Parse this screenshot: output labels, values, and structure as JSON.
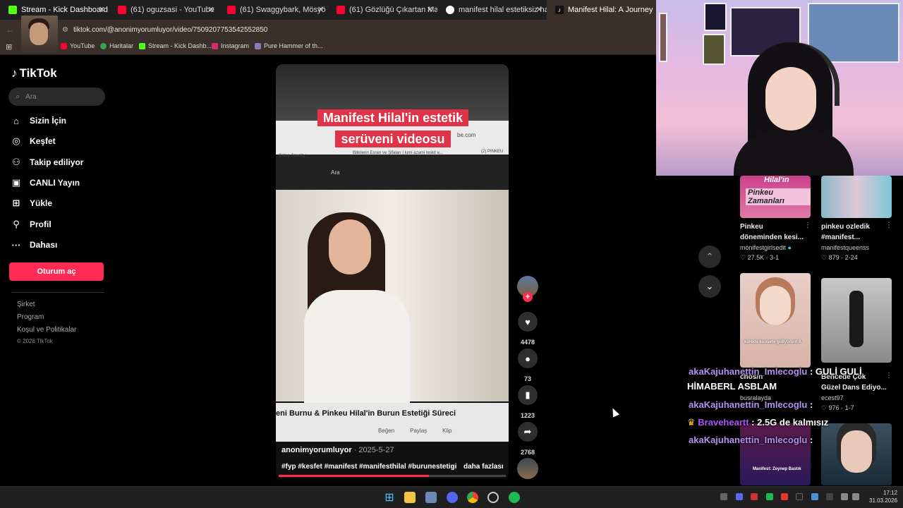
{
  "browser": {
    "tabs": [
      {
        "title": "Stream - Kick Dashboard",
        "color": "#53fc18"
      },
      {
        "title": "(61) oguzsasi - YouTube",
        "color": "#ff0033"
      },
      {
        "title": "(61) Swaggybark, Mösyö Taha T",
        "color": "#ff0033"
      },
      {
        "title": "(61) Gözlüğü Çıkartan Manifest",
        "color": "#ff0033"
      },
      {
        "title": "manifest hilal estetiksiz hali - G",
        "color": "#ffffff"
      },
      {
        "title": "Manifest Hilal: A Journey",
        "color": "#111111"
      }
    ],
    "url": "tiktok.com/@anonimyorumluyor/video/7509207753542552850",
    "bookmarks": [
      "YouTube",
      "Haritalar",
      "Stream - Kick Dashb...",
      "Instagram",
      "Pure Hammer of th..."
    ]
  },
  "sidebar": {
    "logo": "TikTok",
    "search_placeholder": "Ara",
    "nav": [
      {
        "label": "Sizin İçin",
        "icon": "home-icon"
      },
      {
        "label": "Keşfet",
        "icon": "compass-icon"
      },
      {
        "label": "Takip ediliyor",
        "icon": "following-icon"
      },
      {
        "label": "CANLI Yayın",
        "icon": "live-icon"
      },
      {
        "label": "Yükle",
        "icon": "upload-icon"
      },
      {
        "label": "Profil",
        "icon": "profile-icon"
      },
      {
        "label": "Dahası",
        "icon": "more-icon"
      }
    ],
    "login": "Oturum aç",
    "footer": [
      "Şirket",
      "Program",
      "Koşul ve Politikalar",
      "© 2026 TikTok"
    ]
  },
  "video": {
    "overlay_title_1": "Manifest Hilal'in estetik",
    "overlay_title_2": "serüveni videosu",
    "inner_texts": [
      "be.com",
      "Cetaş Jewelry",
      "Bitkilerin Esrarı ve Şifaları | lumi azami teskit e...",
      "(2) PINKEU",
      "Ara"
    ],
    "subtitle": "eni Burnu & Pinkeu Hilal'in Burun Estetiği Süreci",
    "sub_actions": [
      "Beğen",
      "Paylaş",
      "Klip"
    ],
    "author": "anonimyorumluyor",
    "date": "· 2025-5-27",
    "tags": "#fyp #kesfet #manifest #manifesthilal #burunestetigi",
    "more": "daha fazlası",
    "progress": 0.66
  },
  "actions": {
    "likes": "4478",
    "comments": "73",
    "saves": "1223",
    "shares": "2768"
  },
  "related": [
    {
      "title1": "Pinkeu",
      "title2": "döneminden kesi...",
      "author": "mönifestgirlsedit",
      "likes": "27.5K",
      "ep": "3-1",
      "thumb_text": "Pinkeu Zamanları",
      "thumb_header": "Hilal'in"
    },
    {
      "title1": "pinkeu ozledik",
      "title2": "#manifest...",
      "author": "manifestqueenss",
      "likes": "879",
      "ep": "2-24"
    },
    {
      "title1": "chos/n",
      "author": "busralayda",
      "thumb_text": "korede konsere gidiyorum A"
    },
    {
      "title1": "Bencede Çok",
      "title2": "Güzel Dans Ediyo...",
      "author": "ecest97",
      "likes": "976",
      "ep": "1-7"
    },
    {
      "thumb_text": "Manifest: Zeynep Bastık"
    }
  ],
  "chat": [
    {
      "user": "akaKajuhanettin_Imlecoglu",
      "msg": ": GULİ GULİ"
    },
    {
      "user": "",
      "msg": "HİMABERL ASBLAM"
    },
    {
      "user": "akaKajuhanettin_Imlecoglu",
      "msg": ":"
    },
    {
      "user": "Braveheartt",
      "msg": ": 2.5G de kalmısız"
    },
    {
      "user": "akaKajuhanettin_Imlecoglu",
      "msg": ":"
    }
  ],
  "taskbar": {
    "time": "17:12",
    "date": "31.03.2026"
  },
  "colors": {
    "accent": "#fe2c55",
    "chat_user": "#b690f0",
    "chat_user2": "#a855f7"
  }
}
